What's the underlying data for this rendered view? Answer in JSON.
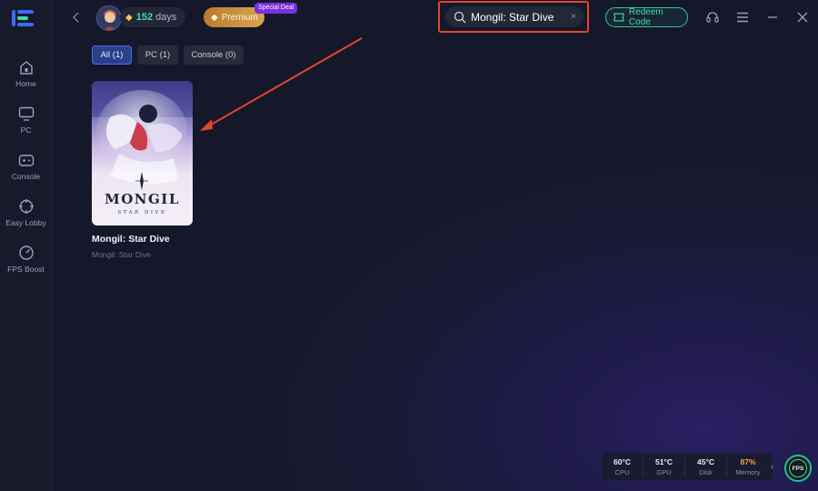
{
  "sidebar": {
    "items": [
      {
        "label": "Home",
        "icon": "home-icon"
      },
      {
        "label": "PC",
        "icon": "monitor-icon"
      },
      {
        "label": "Console",
        "icon": "gamepad-icon"
      },
      {
        "label": "Easy Lobby",
        "icon": "crosshair-icon"
      },
      {
        "label": "FPS Boost",
        "icon": "speedometer-icon"
      }
    ]
  },
  "header": {
    "days_count": "152",
    "days_unit": "days",
    "premium_label": "Premium",
    "special_badge": "Special Deal",
    "search_value": "Mongil: Star Dive",
    "redeem_label": "Redeem Code"
  },
  "filters": [
    {
      "label": "All (1)",
      "active": true
    },
    {
      "label": "PC (1)",
      "active": false
    },
    {
      "label": "Console (0)",
      "active": false
    }
  ],
  "results": [
    {
      "title": "Mongil: Star Dive",
      "subtitle": "Mongil: Star Dive",
      "cover_logo": "MONGIL",
      "cover_tagline": "STAR DIVE"
    }
  ],
  "stats": [
    {
      "value": "60°C",
      "label": "CPU"
    },
    {
      "value": "51°C",
      "label": "GPU"
    },
    {
      "value": "45°C",
      "label": "Disk"
    },
    {
      "value": "87%",
      "label": "Memory"
    }
  ],
  "fps_label": "FPS",
  "colors": {
    "accent_green": "#3ee0a6",
    "highlight_red": "#e0462e",
    "active_tab": "#2c3f8c"
  }
}
